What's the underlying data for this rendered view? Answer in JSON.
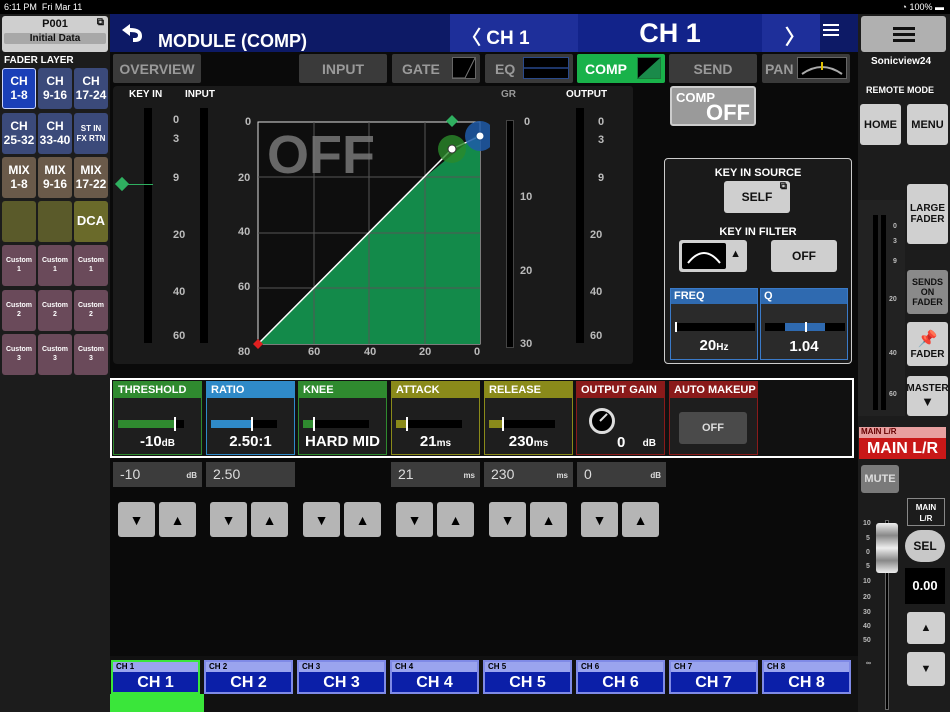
{
  "status_bar": {
    "time": "6:11 PM",
    "date": "Fri Mar 11",
    "battery": "100%"
  },
  "left_panel": {
    "preset_id": "P001",
    "preset_name": "Initial Data",
    "fader_layer_label": "FADER LAYER",
    "tiles": [
      {
        "l1": "CH",
        "l2": "1-8"
      },
      {
        "l1": "CH",
        "l2": "9-16"
      },
      {
        "l1": "CH",
        "l2": "17-24"
      },
      {
        "l1": "CH",
        "l2": "25-32"
      },
      {
        "l1": "CH",
        "l2": "33-40"
      },
      {
        "l1": "ST IN",
        "l2": "FX RTN"
      },
      {
        "l1": "MIX",
        "l2": "1-8"
      },
      {
        "l1": "MIX",
        "l2": "9-16"
      },
      {
        "l1": "MIX",
        "l2": "17-22"
      },
      {
        "l1": "",
        "l2": ""
      },
      {
        "l1": "",
        "l2": ""
      },
      {
        "l1": "DCA",
        "l2": ""
      },
      {
        "l1": "Custom",
        "l2": "1"
      },
      {
        "l1": "Custom",
        "l2": "1"
      },
      {
        "l1": "Custom",
        "l2": "1"
      },
      {
        "l1": "Custom",
        "l2": "2"
      },
      {
        "l1": "Custom",
        "l2": "2"
      },
      {
        "l1": "Custom",
        "l2": "2"
      },
      {
        "l1": "Custom",
        "l2": "3"
      },
      {
        "l1": "Custom",
        "l2": "3"
      },
      {
        "l1": "Custom",
        "l2": "3"
      }
    ]
  },
  "header": {
    "back_icon": "undo-arrow-icon",
    "title": "MODULE (COMP)",
    "ch_prev": "CH 1",
    "ch_current": "CH 1",
    "menu_icon": "hamburger-icon"
  },
  "tabs": {
    "overview": "OVERVIEW",
    "input": "INPUT",
    "gate": "GATE",
    "eq": "EQ",
    "comp": "COMP",
    "send": "SEND",
    "pan": "PAN"
  },
  "graph": {
    "key_in_label": "KEY IN",
    "input_label": "INPUT",
    "gr_label": "GR",
    "output_label": "OUTPUT",
    "off_overlay": "OFF",
    "left_scale": [
      "0",
      "3",
      "9",
      "20",
      "40",
      "60"
    ],
    "y_scale": [
      "0",
      "20",
      "40",
      "60",
      "80"
    ],
    "x_scale": [
      "60",
      "40",
      "20",
      "0"
    ],
    "gr_scale": [
      "0",
      "10",
      "20",
      "30"
    ],
    "out_scale": [
      "0",
      "3",
      "9",
      "20",
      "40",
      "60"
    ]
  },
  "comp_toggle": {
    "label": "COMP",
    "state": "OFF"
  },
  "key_in": {
    "source_label": "KEY IN SOURCE",
    "source_value": "SELF",
    "filter_label": "KEY IN FILTER",
    "filter_state": "OFF",
    "freq_label": "FREQ",
    "freq_value": "20",
    "freq_unit": "Hz",
    "q_label": "Q",
    "q_value": "1.04"
  },
  "params": [
    {
      "label": "THRESHOLD",
      "value": "-10",
      "unit": "dB",
      "color": "#2f8a2f",
      "level": 0.85
    },
    {
      "label": "RATIO",
      "value": "2.50:1",
      "unit": "",
      "color": "#2f8ac8",
      "level": 0.6
    },
    {
      "label": "KNEE",
      "value": "HARD MID",
      "unit": "",
      "color": "#2f8a2f",
      "level": 0.15
    },
    {
      "label": "ATTACK",
      "value": "21",
      "unit": "ms",
      "color": "#8a8a1a",
      "level": 0.15
    },
    {
      "label": "RELEASE",
      "value": "230",
      "unit": "ms",
      "color": "#8a8a1a",
      "level": 0.2
    },
    {
      "label": "OUTPUT GAIN",
      "value": "0",
      "unit": "dB",
      "color": "#8a1a1a",
      "level": 0.5
    },
    {
      "label": "AUTO MAKEUP",
      "value": "OFF",
      "unit": "",
      "color": "#8a1a1a",
      "level": 0
    }
  ],
  "fields": [
    {
      "value": "-10",
      "unit": "dB"
    },
    {
      "value": "2.50",
      "unit": ""
    },
    {
      "value": "21",
      "unit": "ms"
    },
    {
      "value": "230",
      "unit": "ms"
    },
    {
      "value": "0",
      "unit": "dB"
    }
  ],
  "channels": [
    {
      "sm": "CH 1",
      "lg": "CH 1"
    },
    {
      "sm": "CH 2",
      "lg": "CH 2"
    },
    {
      "sm": "CH 3",
      "lg": "CH 3"
    },
    {
      "sm": "CH 4",
      "lg": "CH 4"
    },
    {
      "sm": "CH 5",
      "lg": "CH 5"
    },
    {
      "sm": "CH 6",
      "lg": "CH 6"
    },
    {
      "sm": "CH 7",
      "lg": "CH 7"
    },
    {
      "sm": "CH 8",
      "lg": "CH 8"
    }
  ],
  "right_panel": {
    "device": "Sonicview24",
    "remote_mode": "REMOTE MODE",
    "home": "HOME",
    "menu": "MENU",
    "large_fader_1": "LARGE",
    "large_fader_2": "FADER",
    "sends_1": "SENDS",
    "sends_2": "ON",
    "sends_3": "FADER",
    "fader_pin": "FADER",
    "master": "MASTER",
    "main_small": "MAIN L/R",
    "main_large": "MAIN L/R",
    "mute": "MUTE",
    "main_lr_1": "MAIN",
    "main_lr_2": "L/R",
    "sel": "SEL",
    "fader_value": "0.00",
    "meter_scale": [
      "0",
      "3",
      "9",
      "20",
      "40",
      "60"
    ],
    "fader_scale": [
      "10",
      "5",
      "0",
      "5",
      "10",
      "20",
      "30",
      "40",
      "50",
      "∞"
    ]
  }
}
